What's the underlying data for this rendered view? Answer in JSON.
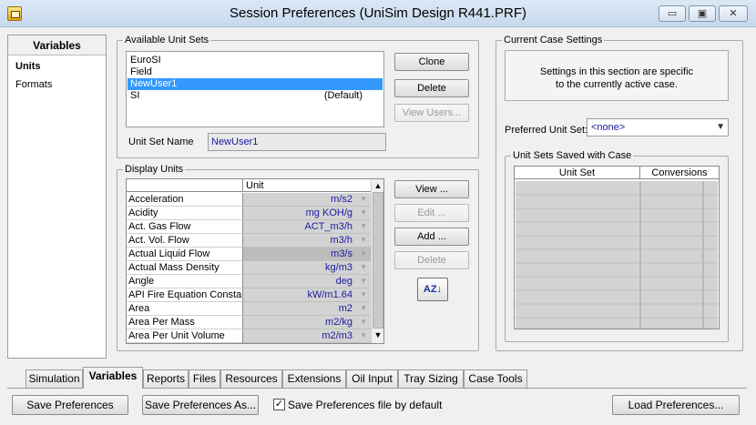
{
  "window": {
    "title": "Session Preferences (UniSim Design R441.PRF)",
    "controls": {
      "minimize": "▭",
      "restore": "▣",
      "close": "✕"
    }
  },
  "left": {
    "header": "Variables",
    "items": [
      "Units",
      "Formats"
    ]
  },
  "available_units": {
    "group_label": "Available Unit Sets",
    "sets": [
      {
        "name": "EuroSI",
        "note": ""
      },
      {
        "name": "Field",
        "note": ""
      },
      {
        "name": "NewUser1",
        "note": ""
      },
      {
        "name": "SI",
        "note": "(Default)"
      }
    ],
    "selected": "NewUser1",
    "clone_label": "Clone",
    "delete_label": "Delete",
    "view_users_label": "View Users...",
    "unit_set_name_label": "Unit Set Name",
    "unit_set_name_value": "NewUser1"
  },
  "display_units": {
    "group_label": "Display Units",
    "column_header": "Unit",
    "rows": [
      {
        "name": "Acceleration",
        "unit": "m/s2"
      },
      {
        "name": "Acidity",
        "unit": "mg KOH/g"
      },
      {
        "name": "Act. Gas Flow",
        "unit": "ACT_m3/h"
      },
      {
        "name": "Act. Vol. Flow",
        "unit": "m3/h"
      },
      {
        "name": "Actual Liquid Flow",
        "unit": "m3/s"
      },
      {
        "name": "Actual Mass Density",
        "unit": "kg/m3"
      },
      {
        "name": "Angle",
        "unit": "deg"
      },
      {
        "name": "API Fire Equation Constant",
        "unit": "kW/m1.64"
      },
      {
        "name": "Area",
        "unit": "m2"
      },
      {
        "name": "Area Per Mass",
        "unit": "m2/kg"
      },
      {
        "name": "Area Per Unit Volume",
        "unit": "m2/m3"
      }
    ],
    "view_label": "View ...",
    "edit_label": "Edit ...",
    "add_label": "Add ...",
    "delete_label": "Delete",
    "sort_label": "AZ↓"
  },
  "current_case": {
    "group_label": "Current Case Settings",
    "info_line1": "Settings in this section are specific",
    "info_line2": "to the currently active case.",
    "preferred_label": "Preferred Unit Set:",
    "preferred_value": "<none>",
    "saved_group_label": "Unit Sets Saved with Case",
    "saved_columns": [
      "Unit Set",
      "Conversions"
    ]
  },
  "tabs": [
    "Simulation",
    "Variables",
    "Reports",
    "Files",
    "Resources",
    "Extensions",
    "Oil Input",
    "Tray Sizing",
    "Case Tools"
  ],
  "active_tab": "Variables",
  "bottom": {
    "save_label": "Save Preferences",
    "save_as_label": "Save Preferences As...",
    "default_check_label": "Save Preferences file by default",
    "default_checked": true,
    "load_label": "Load Preferences..."
  }
}
